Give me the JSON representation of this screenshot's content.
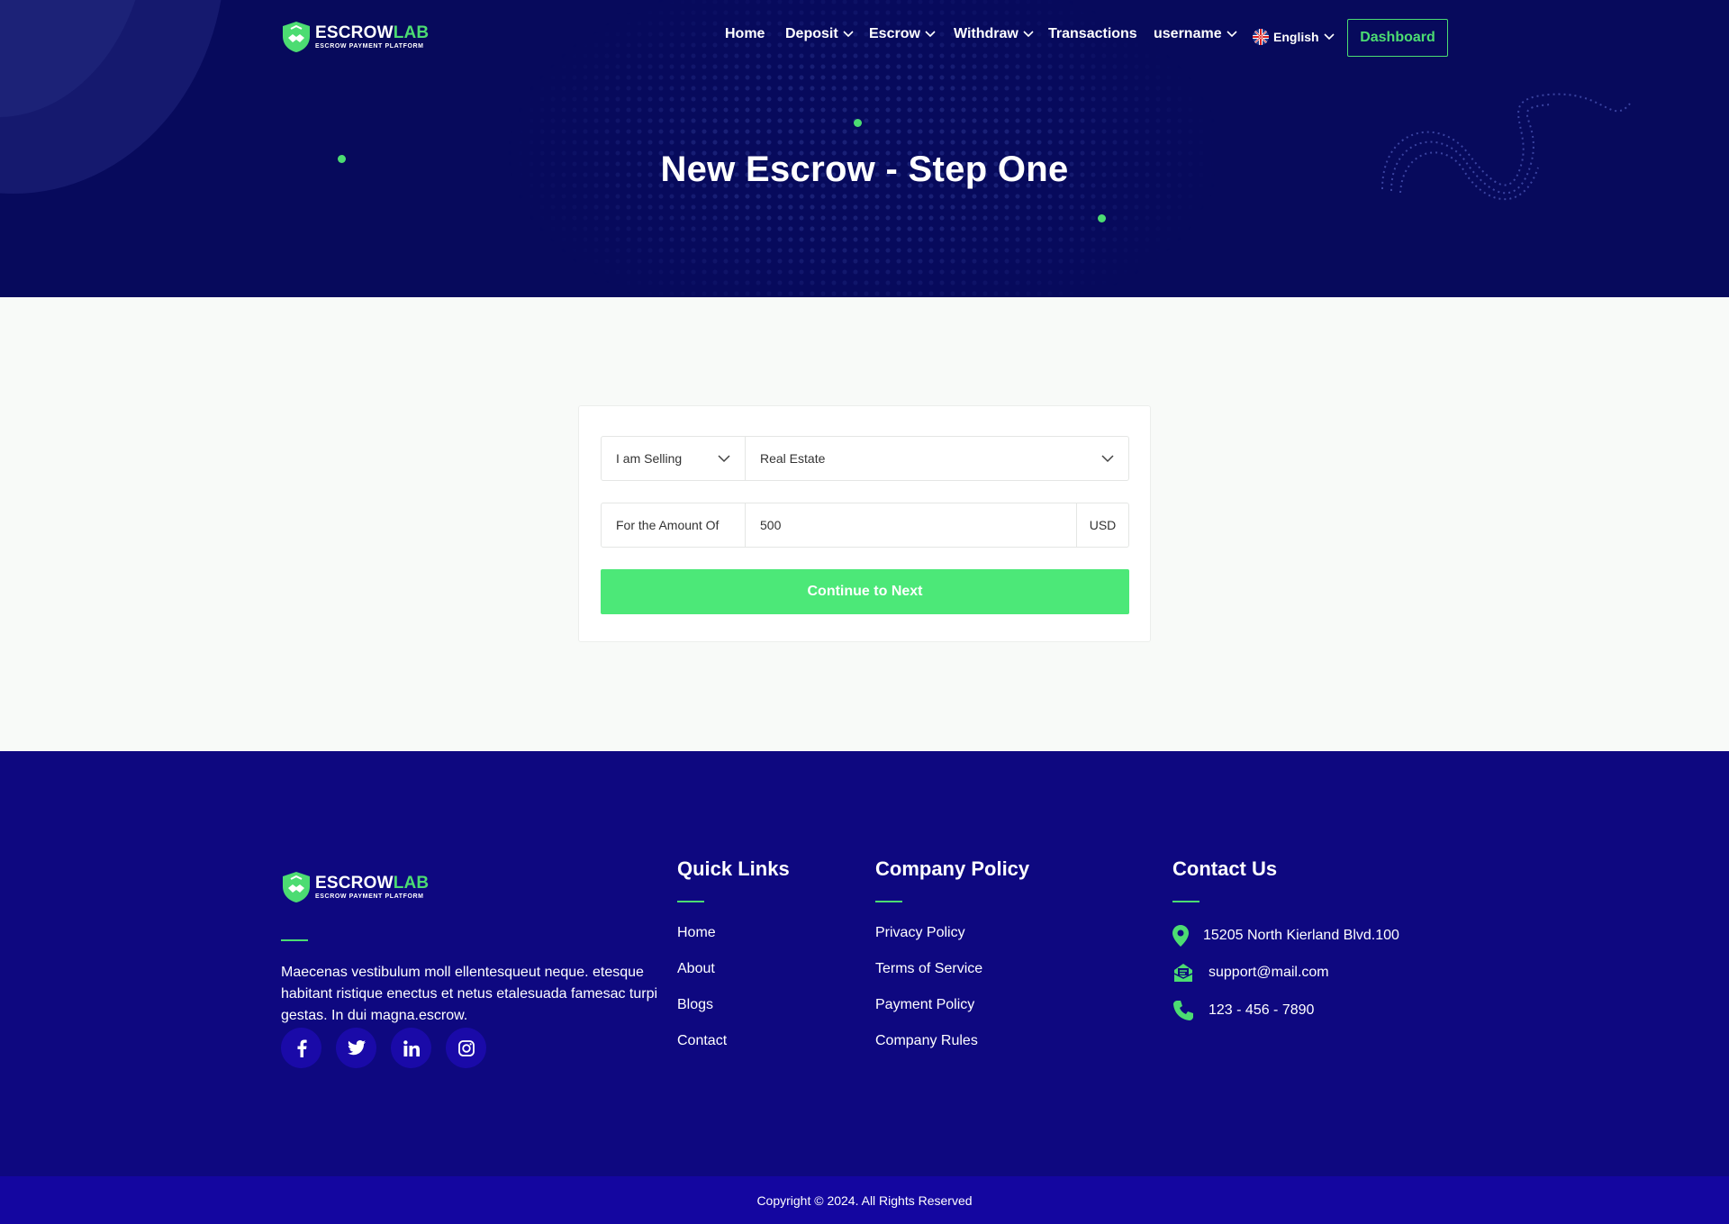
{
  "brand": {
    "name_part1": "ESCROW",
    "name_part2": "LAB",
    "tagline": "ESCROW PAYMENT PLATFORM"
  },
  "nav": {
    "items": [
      {
        "label": "Home"
      },
      {
        "label": "Deposit"
      },
      {
        "label": "Escrow"
      },
      {
        "label": "Withdraw"
      },
      {
        "label": "Transactions"
      },
      {
        "label": "username"
      }
    ],
    "language": "English",
    "dashboard_label": "Dashboard"
  },
  "hero": {
    "title": "New Escrow - Step One"
  },
  "form": {
    "role_selected": "I am Selling",
    "category_selected": "Real Estate",
    "amount_label": "For the Amount Of",
    "amount_value": "500",
    "currency": "USD",
    "submit_label": "Continue to Next"
  },
  "footer": {
    "about_text": "Maecenas vestibulum moll ellentesqueut neque. etesque habitant ristique enectus et netus etalesuada famesac turpi gestas. In dui magna.escrow.",
    "socials": [
      "facebook-icon",
      "twitter-icon",
      "linkedin-icon",
      "instagram-icon"
    ],
    "quick_links": {
      "title": "Quick Links",
      "items": [
        "Home",
        "About",
        "Blogs",
        "Contact"
      ]
    },
    "company_policy": {
      "title": "Company Policy",
      "items": [
        "Privacy Policy",
        "Terms of Service",
        "Payment Policy",
        "Company Rules"
      ]
    },
    "contact": {
      "title": "Contact Us",
      "address": "15205 North Kierland Blvd.100",
      "email": "support@mail.com",
      "phone": "123 - 456 - 7890"
    },
    "copyright": "Copyright © 2024. All Rights Reserved"
  },
  "colors": {
    "accent": "#4cdc72",
    "hero_bg": "#070a5c",
    "footer_bg": "#0e0880",
    "copyright_bg": "#1406a0",
    "button_bg": "#4ce878"
  }
}
